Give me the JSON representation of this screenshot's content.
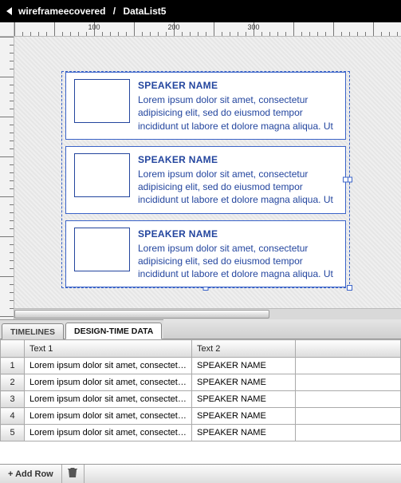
{
  "breadcrumb": {
    "back": true,
    "item0": "wireframeecovered",
    "sep": "/",
    "item1": "DataList5"
  },
  "ruler": {
    "major": [
      100,
      200,
      300
    ],
    "vmajor": []
  },
  "cards": [
    {
      "title": "SPEAKER NAME",
      "body": "Lorem ipsum dolor sit amet, consectetur adipisicing elit, sed do eiusmod tempor incididunt ut labore et dolore magna aliqua. Ut"
    },
    {
      "title": "SPEAKER NAME",
      "body": "Lorem ipsum dolor sit amet, consectetur adipisicing elit, sed do eiusmod tempor incididunt ut labore et dolore magna aliqua. Ut"
    },
    {
      "title": "SPEAKER NAME",
      "body": "Lorem ipsum dolor sit amet, consectetur adipisicing elit, sed do eiusmod tempor incididunt ut labore et dolore magna aliqua. Ut"
    }
  ],
  "tabs": {
    "timelines": "TIMELINES",
    "designtime": "DESIGN-TIME DATA"
  },
  "grid": {
    "headers": {
      "rownum": "",
      "col1": "Text 1",
      "col2": "Text 2"
    },
    "rows": [
      {
        "n": "1",
        "c1": "Lorem ipsum dolor sit amet, consectetur ad...",
        "c2": "SPEAKER NAME"
      },
      {
        "n": "2",
        "c1": "Lorem ipsum dolor sit amet, consectetur ad...",
        "c2": "SPEAKER NAME"
      },
      {
        "n": "3",
        "c1": "Lorem ipsum dolor sit amet, consectetur ad...",
        "c2": "SPEAKER NAME"
      },
      {
        "n": "4",
        "c1": "Lorem ipsum dolor sit amet, consectetur ad...",
        "c2": "SPEAKER NAME"
      },
      {
        "n": "5",
        "c1": "Lorem ipsum dolor sit amet, consectetur ad...",
        "c2": "SPEAKER NAME"
      }
    ]
  },
  "footer": {
    "addrow": "+  Add Row"
  }
}
